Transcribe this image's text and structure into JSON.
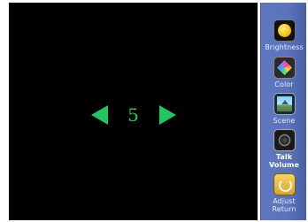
{
  "adjust": {
    "value": "5",
    "decrease_icon": "left-triangle-arrow",
    "increase_icon": "right-triangle-arrow",
    "accent_color": "#22c55e"
  },
  "sidebar": {
    "items": [
      {
        "id": "brightness",
        "label": "Brightness",
        "icon": "sun-icon"
      },
      {
        "id": "color",
        "label": "Color",
        "icon": "color-cube-icon"
      },
      {
        "id": "scene",
        "label": "Scene",
        "icon": "scene-house-icon"
      },
      {
        "id": "talk_volume",
        "label_line1": "Talk",
        "label_line2": "Volume",
        "icon": "speaker-icon"
      },
      {
        "id": "adjust_return",
        "label_line1": "Adjust",
        "label_line2": "Return",
        "icon": "return-icon"
      }
    ]
  }
}
